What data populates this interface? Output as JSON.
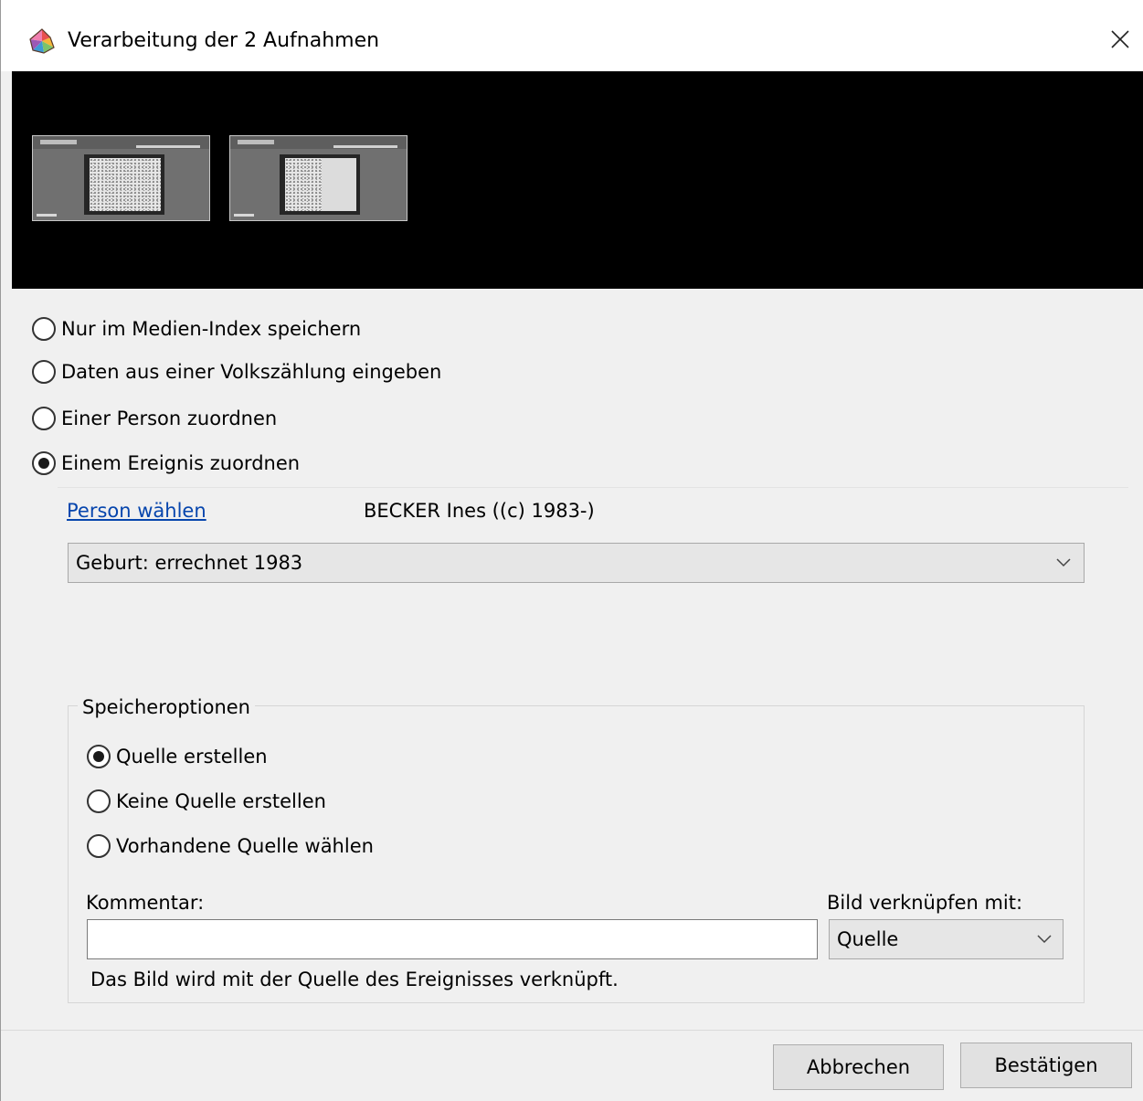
{
  "window": {
    "title": "Verarbeitung der 2 Aufnahmen",
    "app_icon": "app-logo-icon",
    "close_icon": "close-icon"
  },
  "thumbnails": {
    "count": 2
  },
  "processing_options": [
    {
      "label": "Nur im Medien-Index speichern",
      "checked": false
    },
    {
      "label": "Daten aus einer Volkszählung eingeben",
      "checked": false
    },
    {
      "label": "Einer Person zuordnen",
      "checked": false
    },
    {
      "label": "Einem Ereignis zuordnen",
      "checked": true
    }
  ],
  "person": {
    "link_label": "Person wählen",
    "selected_name": "BECKER Ines ((c) 1983-)"
  },
  "event_select": {
    "value": "Geburt: errechnet 1983"
  },
  "save_options": {
    "title": "Speicheroptionen",
    "options": [
      {
        "label": "Quelle erstellen",
        "checked": true
      },
      {
        "label": "Keine Quelle erstellen",
        "checked": false
      },
      {
        "label": "Vorhandene Quelle wählen",
        "checked": false
      }
    ],
    "comment_label": "Kommentar:",
    "comment_value": "",
    "link_label": "Bild verknüpfen mit:",
    "link_value": "Quelle",
    "hint": "Das Bild wird mit der Quelle des Ereignisses verknüpft."
  },
  "buttons": {
    "cancel": "Abbrechen",
    "confirm": "Bestätigen"
  },
  "colors": {
    "link": "#0645ad",
    "strip_background": "#000000",
    "dialog_background": "#f0f0f0"
  }
}
